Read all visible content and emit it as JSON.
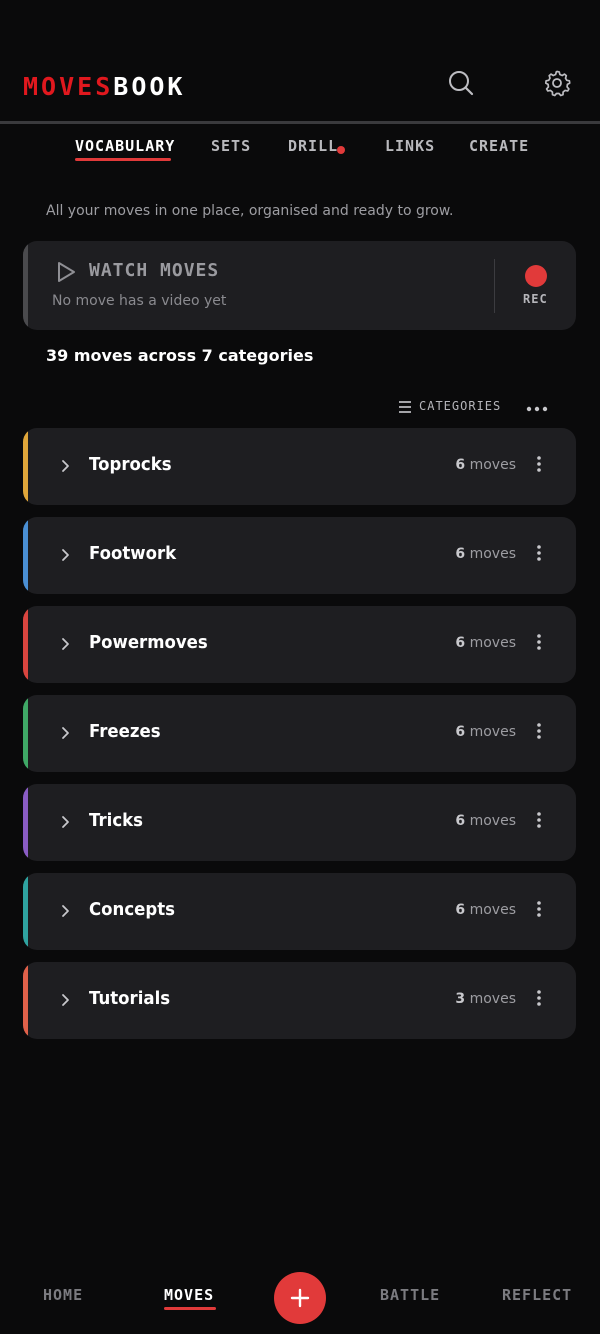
{
  "app": {
    "logo_part1": "MOVES",
    "logo_part2": "BOOK"
  },
  "header": {
    "search_icon": "search-icon",
    "settings_icon": "gear-icon"
  },
  "tabs": [
    {
      "label": "VOCABULARY",
      "active": true
    },
    {
      "label": "SETS",
      "active": false
    },
    {
      "label": "DRILL",
      "active": false,
      "notification_dot": true
    },
    {
      "label": "LINKS",
      "active": false
    },
    {
      "label": "CREATE",
      "active": false
    }
  ],
  "tagline": "All your moves in one place, organised and ready to grow.",
  "watch": {
    "title": "WATCH MOVES",
    "subtitle": "No move has a video yet",
    "rec_label": "REC"
  },
  "summary": "39 moves across 7 categories",
  "toolbar": {
    "categories_label": "CATEGORIES"
  },
  "categories": [
    {
      "name": "Toprocks",
      "count": "6",
      "unit": "moves",
      "color": "#e0a63a"
    },
    {
      "name": "Footwork",
      "count": "6",
      "unit": "moves",
      "color": "#4a8fd4"
    },
    {
      "name": "Powermoves",
      "count": "6",
      "unit": "moves",
      "color": "#d9453f"
    },
    {
      "name": "Freezes",
      "count": "6",
      "unit": "moves",
      "color": "#3fa866"
    },
    {
      "name": "Tricks",
      "count": "6",
      "unit": "moves",
      "color": "#8a5cc4"
    },
    {
      "name": "Concepts",
      "count": "6",
      "unit": "moves",
      "color": "#2fa3a0"
    },
    {
      "name": "Tutorials",
      "count": "3",
      "unit": "moves",
      "color": "#e0614a"
    }
  ],
  "bottom_nav": [
    {
      "label": "HOME",
      "active": false
    },
    {
      "label": "MOVES",
      "active": true
    },
    {
      "label": "BATTLE",
      "active": false
    },
    {
      "label": "REFLECT",
      "active": false
    }
  ],
  "colors": {
    "accent": "#e13a3a",
    "brand_red": "#e1181e",
    "card_bg": "#1e1e21",
    "background": "#0a0a0b"
  }
}
